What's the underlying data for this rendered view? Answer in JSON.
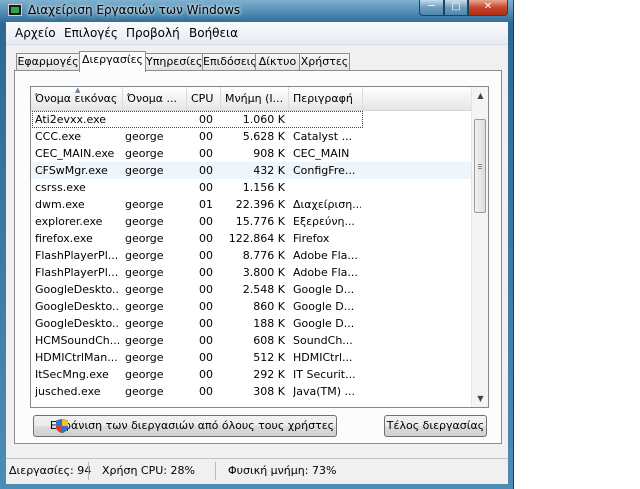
{
  "window": {
    "title": "Διαχείριση Εργασιών των Windows"
  },
  "menu": [
    "Αρχείο",
    "Επιλογές",
    "Προβολή",
    "Βοήθεια"
  ],
  "tabs": [
    "Εφαρμογές",
    "Διεργασίες",
    "Υπηρεσίες",
    "Επιδόσεις",
    "Δίκτυο",
    "Χρήστες"
  ],
  "active_tab": "Διεργασίες",
  "columns": [
    "Όνομα εικόνας",
    "Όνομα ...",
    "CPU",
    "Μνήμη (Ι...",
    "Περιγραφή"
  ],
  "rows": [
    {
      "name": "Ati2evxx.exe",
      "user": "",
      "cpu": "00",
      "mem": "1.060 K",
      "desc": ""
    },
    {
      "name": "CCC.exe",
      "user": "george",
      "cpu": "00",
      "mem": "5.628 K",
      "desc": "Catalyst ..."
    },
    {
      "name": "CEC_MAIN.exe",
      "user": "george",
      "cpu": "00",
      "mem": "908 K",
      "desc": "CEC_MAIN"
    },
    {
      "name": "CFSwMgr.exe",
      "user": "george",
      "cpu": "00",
      "mem": "432 K",
      "desc": "ConfigFre..."
    },
    {
      "name": "csrss.exe",
      "user": "",
      "cpu": "00",
      "mem": "1.156 K",
      "desc": ""
    },
    {
      "name": "dwm.exe",
      "user": "george",
      "cpu": "01",
      "mem": "22.396 K",
      "desc": "Διαχείριση..."
    },
    {
      "name": "explorer.exe",
      "user": "george",
      "cpu": "00",
      "mem": "15.776 K",
      "desc": "Εξερεύνη..."
    },
    {
      "name": "firefox.exe",
      "user": "george",
      "cpu": "00",
      "mem": "122.864 K",
      "desc": "Firefox"
    },
    {
      "name": "FlashPlayerPl...",
      "user": "george",
      "cpu": "00",
      "mem": "8.776 K",
      "desc": "Adobe Fla..."
    },
    {
      "name": "FlashPlayerPl...",
      "user": "george",
      "cpu": "00",
      "mem": "3.800 K",
      "desc": "Adobe Fla..."
    },
    {
      "name": "GoogleDeskto...",
      "user": "george",
      "cpu": "00",
      "mem": "2.548 K",
      "desc": "Google D..."
    },
    {
      "name": "GoogleDeskto...",
      "user": "george",
      "cpu": "00",
      "mem": "860 K",
      "desc": "Google D..."
    },
    {
      "name": "GoogleDeskto...",
      "user": "george",
      "cpu": "00",
      "mem": "188 K",
      "desc": "Google D..."
    },
    {
      "name": "HCMSoundCh...",
      "user": "george",
      "cpu": "00",
      "mem": "608 K",
      "desc": "SoundCh..."
    },
    {
      "name": "HDMICtrlMan...",
      "user": "george",
      "cpu": "00",
      "mem": "512 K",
      "desc": "HDMICtrl..."
    },
    {
      "name": "ItSecMng.exe",
      "user": "george",
      "cpu": "00",
      "mem": "292 K",
      "desc": "IT Securit..."
    },
    {
      "name": "jusched.exe",
      "user": "george",
      "cpu": "00",
      "mem": "308 K",
      "desc": "Java(TM) ..."
    }
  ],
  "buttons": {
    "show_all": "Εμφάνιση των διεργασιών από όλους τους χρήστες",
    "end_process": "Τέλος διεργασίας"
  },
  "status": {
    "processes": "Διεργασίες: 94",
    "cpu": "Χρήση CPU: 28%",
    "memory": "Φυσική μνήμη: 73%"
  },
  "colors": {
    "title_bar": "#4d8cb5",
    "close_button": "#c8452a",
    "selection_border": "#444444"
  }
}
